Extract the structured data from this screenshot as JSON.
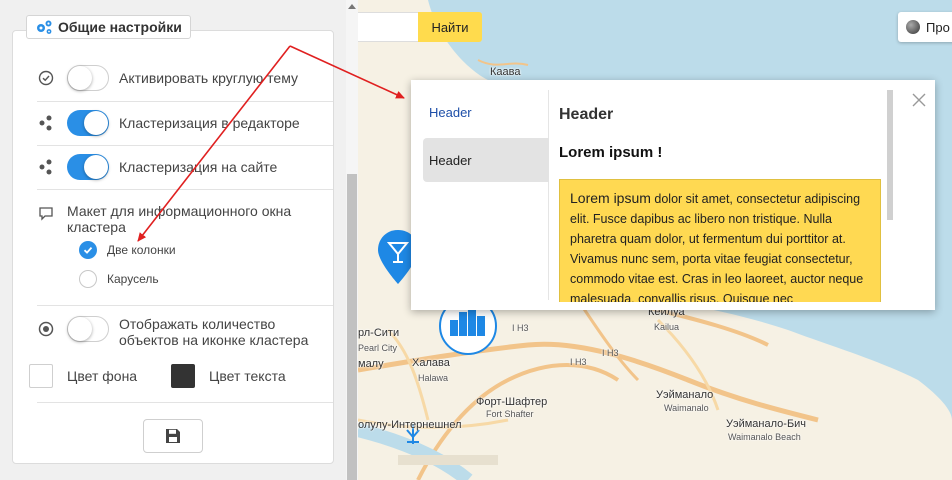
{
  "settings": {
    "title": "Общие настройки",
    "round_theme": {
      "label": "Активировать круглую тему",
      "enabled": false
    },
    "editor_clustering": {
      "label": "Кластеризация в редакторе",
      "enabled": true
    },
    "site_clustering": {
      "label": "Кластеризация на сайте",
      "enabled": true
    },
    "cluster_layout": {
      "label": "Макет для информационного окна кластера",
      "options": [
        "Две колонки",
        "Карусель"
      ],
      "selected": "Две колонки"
    },
    "show_count": {
      "label": "Отображать количество объектов на иконке кластера",
      "enabled": false
    },
    "bg_color": {
      "label": "Цвет фона",
      "value": "#ffffff"
    },
    "text_color": {
      "label": "Цвет текста",
      "value": "#333333"
    }
  },
  "map": {
    "find_button": "Найти",
    "layer_button": "Про",
    "labels": {
      "kaava": "Каава",
      "pearl_city": "рл-Сити",
      "pearl_city_en": "Pearl City",
      "malu": "малу",
      "halava": "Халава",
      "halawa": "Halawa",
      "keilua": "Кейлуа",
      "kailua": "Kailua",
      "fort_shafter": "Форт-Шафтер",
      "fort_shafter_en": "Fort Shafter",
      "honolulu_airport": "олулу-Интернешнел",
      "waimanalo": "Уэйманало",
      "waimanalo_en": "Waimanalo",
      "waimanalo_beach": "Уэйманало-Бич",
      "waimanalo_beach_en": "Waimanalo Beach",
      "h3_a": "I H3",
      "h3_b": "I H3",
      "h3_c": "I H3"
    }
  },
  "balloon": {
    "tabs": [
      "Header",
      "Header"
    ],
    "heading": "Header",
    "subheading": "Lorem ipsum !",
    "body_lead": "Lorem ipsum",
    "body_rest": " dolor sit amet, consectetur adipiscing elit. Fusce dapibus ac libero non tristique. Nulla pharetra quam dolor, ut fermentum dui porttitor at. Vivamus nunc sem, porta vitae feugiat consectetur, commodo vitae est. Cras in leo laoreet, auctor neque malesuada, convallis risus. Quisque nec"
  },
  "colors": {
    "accent": "#2a8fe6",
    "arrow": "#e02020",
    "highlight": "#ffd952",
    "find_button": "#ffdb4d"
  }
}
